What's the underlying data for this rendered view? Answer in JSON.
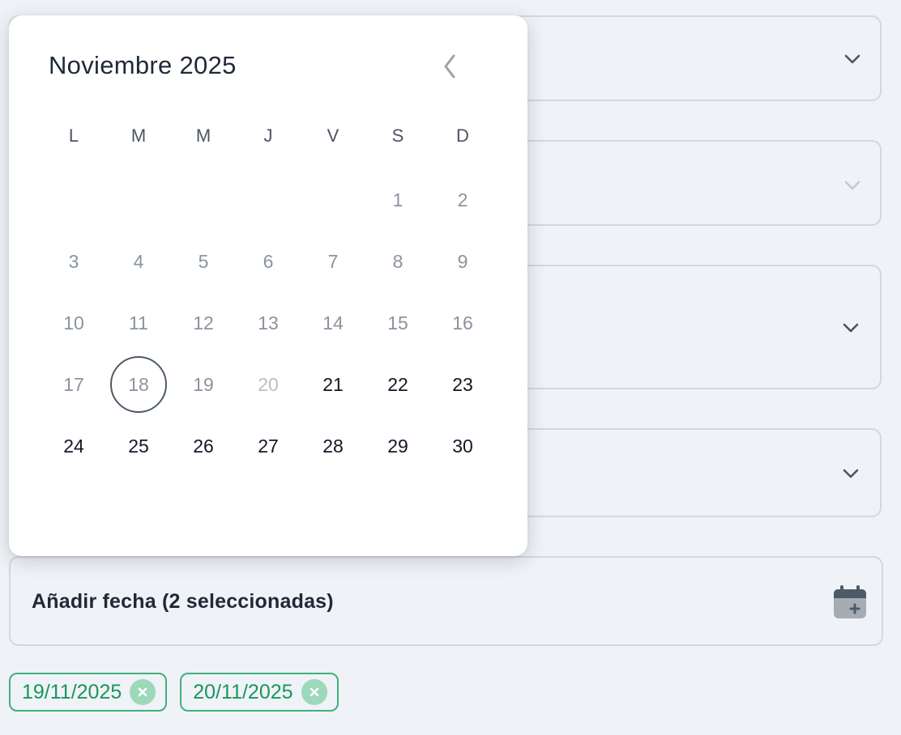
{
  "calendar": {
    "month_title": "Noviembre 2025",
    "weekdays": [
      "L",
      "M",
      "M",
      "J",
      "V",
      "S",
      "D"
    ],
    "weeks": [
      [
        {
          "label": "",
          "state": "empty"
        },
        {
          "label": "",
          "state": "empty"
        },
        {
          "label": "",
          "state": "empty"
        },
        {
          "label": "",
          "state": "empty"
        },
        {
          "label": "",
          "state": "empty"
        },
        {
          "label": "1",
          "state": "past"
        },
        {
          "label": "2",
          "state": "past"
        }
      ],
      [
        {
          "label": "3",
          "state": "past"
        },
        {
          "label": "4",
          "state": "past"
        },
        {
          "label": "5",
          "state": "past"
        },
        {
          "label": "6",
          "state": "past"
        },
        {
          "label": "7",
          "state": "past"
        },
        {
          "label": "8",
          "state": "past"
        },
        {
          "label": "9",
          "state": "past"
        }
      ],
      [
        {
          "label": "10",
          "state": "past"
        },
        {
          "label": "11",
          "state": "past"
        },
        {
          "label": "12",
          "state": "past"
        },
        {
          "label": "13",
          "state": "past"
        },
        {
          "label": "14",
          "state": "past"
        },
        {
          "label": "15",
          "state": "past"
        },
        {
          "label": "16",
          "state": "past"
        }
      ],
      [
        {
          "label": "17",
          "state": "past"
        },
        {
          "label": "18",
          "state": "today"
        },
        {
          "label": "19",
          "state": "past"
        },
        {
          "label": "20",
          "state": "disabled"
        },
        {
          "label": "21",
          "state": "available"
        },
        {
          "label": "22",
          "state": "available"
        },
        {
          "label": "23",
          "state": "available"
        }
      ],
      [
        {
          "label": "24",
          "state": "available"
        },
        {
          "label": "25",
          "state": "available"
        },
        {
          "label": "26",
          "state": "available"
        },
        {
          "label": "27",
          "state": "available"
        },
        {
          "label": "28",
          "state": "available"
        },
        {
          "label": "29",
          "state": "available"
        },
        {
          "label": "30",
          "state": "available"
        }
      ]
    ]
  },
  "add_date": {
    "label": "Añadir fecha (2 seleccionadas)",
    "icon": "calendar-plus-icon"
  },
  "selected_dates": [
    {
      "label": "19/11/2025"
    },
    {
      "label": "20/11/2025"
    }
  ],
  "colors": {
    "background": "#eff2f6",
    "chip_border": "#3fb17c",
    "chip_text": "#19965d",
    "chip_remove_bg": "#9dd8bb"
  }
}
